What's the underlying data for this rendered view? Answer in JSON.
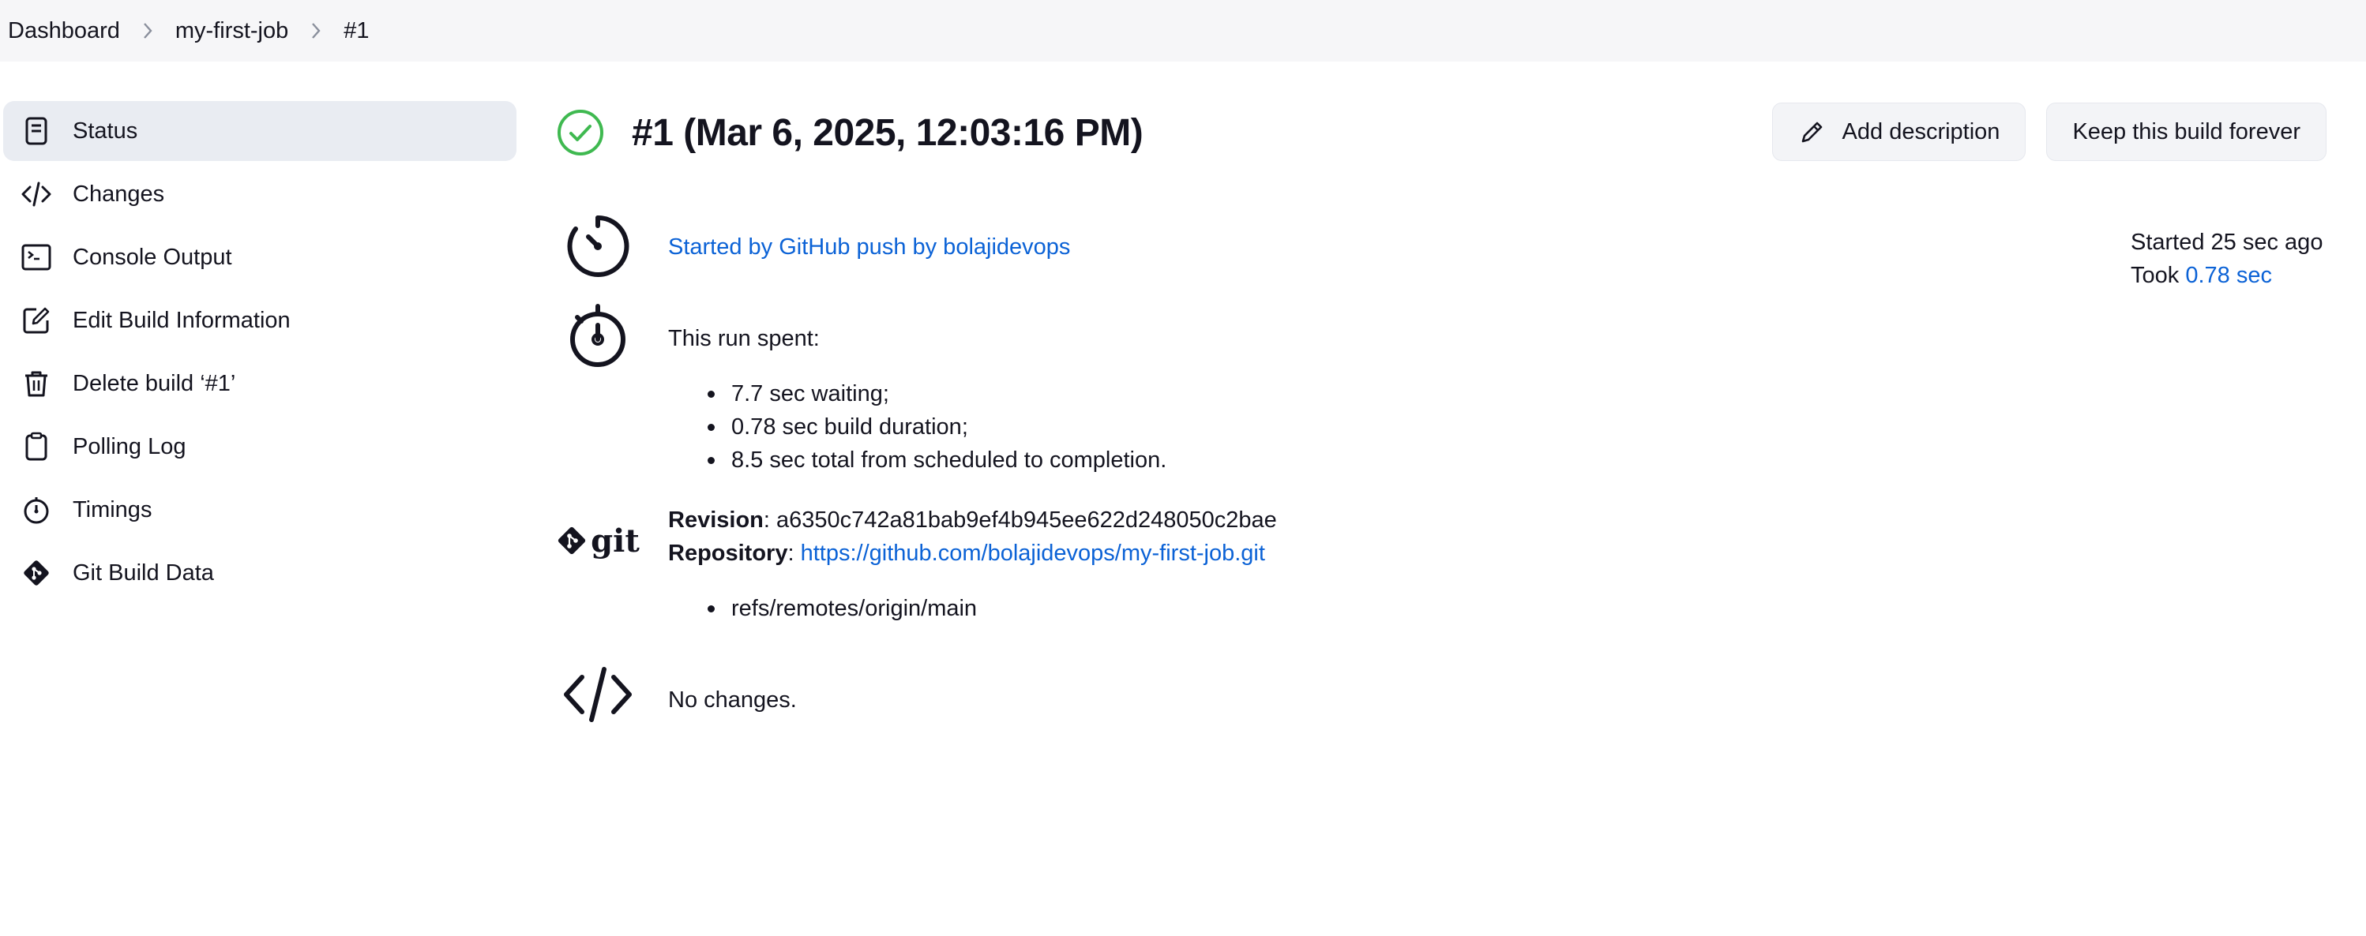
{
  "breadcrumb": {
    "items": [
      "Dashboard",
      "my-first-job",
      "#1"
    ]
  },
  "sidebar": {
    "items": [
      {
        "label": "Status",
        "icon": "document-icon",
        "active": true
      },
      {
        "label": "Changes",
        "icon": "code-icon",
        "active": false
      },
      {
        "label": "Console Output",
        "icon": "terminal-icon",
        "active": false
      },
      {
        "label": "Edit Build Information",
        "icon": "edit-icon",
        "active": false
      },
      {
        "label": "Delete build ‘#1’",
        "icon": "trash-icon",
        "active": false
      },
      {
        "label": "Polling Log",
        "icon": "clipboard-icon",
        "active": false
      },
      {
        "label": "Timings",
        "icon": "stopwatch-icon",
        "active": false
      },
      {
        "label": "Git Build Data",
        "icon": "git-icon",
        "active": false
      }
    ]
  },
  "build": {
    "title": "#1 (Mar 6, 2025, 12:03:16 PM)",
    "status": "success",
    "status_color": "#3fb950"
  },
  "actions": {
    "add_description": "Add description",
    "keep_forever": "Keep this build forever"
  },
  "trigger": {
    "text": "Started by GitHub push by bolajidevops"
  },
  "timing": {
    "intro": "This run spent:",
    "items": [
      "7.7 sec waiting;",
      "0.78 sec build duration;",
      "8.5 sec total from scheduled to completion."
    ]
  },
  "git": {
    "logo_text": "git",
    "revision_label": "Revision",
    "revision": "a6350c742a81bab9ef4b945ee622d248050c2bae",
    "repository_label": "Repository",
    "repository": "https://github.com/bolajidevops/my-first-job.git",
    "refs": [
      "refs/remotes/origin/main"
    ]
  },
  "changes": {
    "text": "No changes."
  },
  "summary": {
    "started": "Started 25 sec ago",
    "took_label": "Took",
    "took_value": "0.78 sec"
  },
  "colors": {
    "link": "#0b62d6",
    "sidebar_active": "#e9ecf2",
    "breadcrumb_bg": "#f6f6f8"
  }
}
